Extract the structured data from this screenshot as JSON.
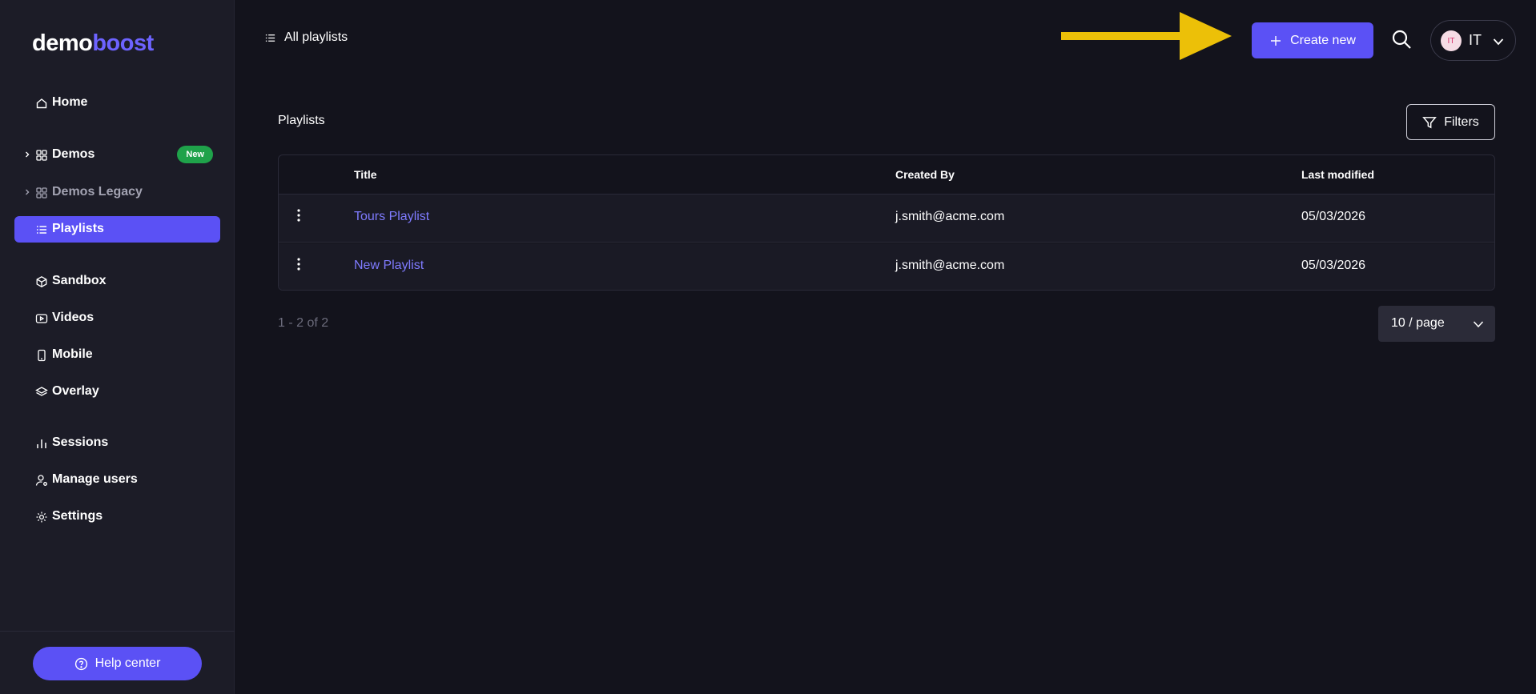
{
  "brand": {
    "part1": "demo",
    "part2": "boost"
  },
  "sidebar": {
    "items": [
      {
        "label": "Home"
      },
      {
        "label": "Demos",
        "badge": "New"
      },
      {
        "label": "Demos Legacy"
      },
      {
        "label": "Playlists"
      },
      {
        "label": "Sandbox"
      },
      {
        "label": "Videos"
      },
      {
        "label": "Mobile"
      },
      {
        "label": "Overlay"
      },
      {
        "label": "Sessions"
      },
      {
        "label": "Manage users"
      },
      {
        "label": "Settings"
      }
    ],
    "help_label": "Help center"
  },
  "header": {
    "breadcrumb": "All playlists",
    "create_label": "Create new",
    "avatar_initials": "IT",
    "user_label": "IT"
  },
  "main": {
    "title": "Playlists",
    "filters_label": "Filters",
    "columns": [
      "Title",
      "Created By",
      "Last modified"
    ],
    "rows": [
      {
        "title": "Tours Playlist",
        "created_by": "j.smith@acme.com",
        "modified": "05/03/2026"
      },
      {
        "title": "New Playlist",
        "created_by": "j.smith@acme.com",
        "modified": "05/03/2026"
      }
    ],
    "pagination": "1 - 2 of 2",
    "page_size": "10 / page"
  },
  "colors": {
    "accent": "#5b51f5",
    "link": "#7f7bff",
    "badge": "#1fa24a",
    "annotation_arrow": "#ecc008"
  }
}
